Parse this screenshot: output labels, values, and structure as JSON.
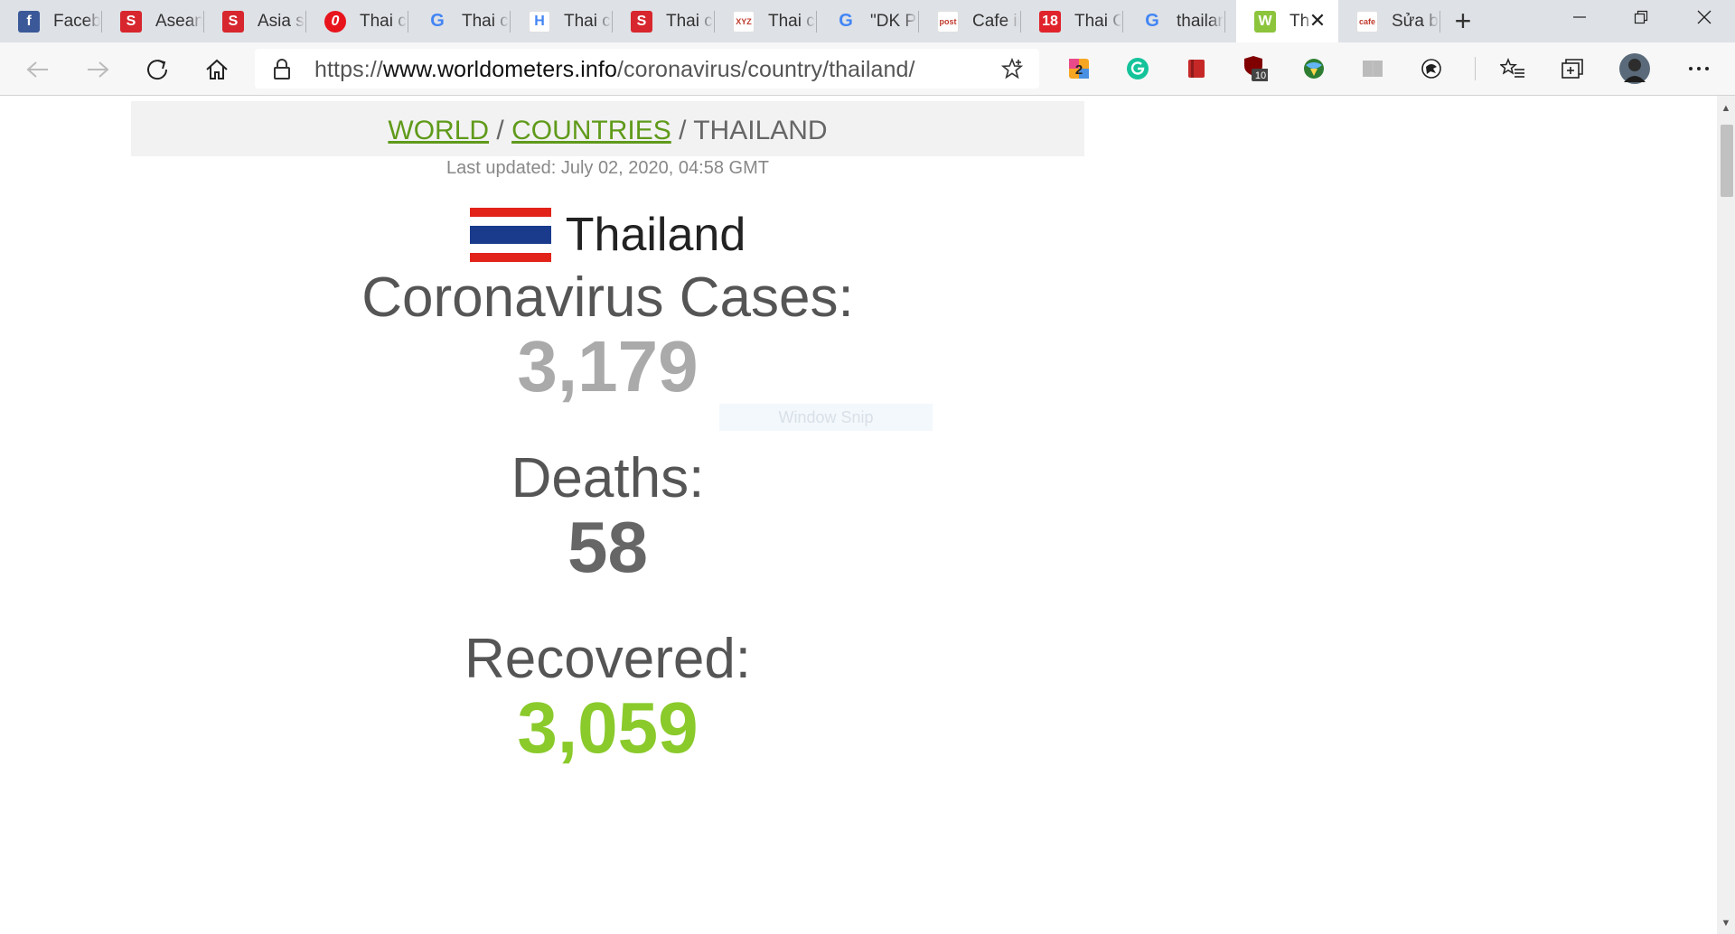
{
  "tabs": [
    {
      "label": "Facebook",
      "icon": "facebook-icon",
      "fav_text": "f",
      "fav_bg": "#3b5998"
    },
    {
      "label": "Asean+",
      "icon": "s-red-icon",
      "fav_text": "S",
      "fav_bg": "#d7262d"
    },
    {
      "label": "Asia stocks",
      "icon": "s-red-icon",
      "fav_text": "S",
      "fav_bg": "#d7262d"
    },
    {
      "label": "Thai cases",
      "icon": "opera-icon",
      "fav_text": "0",
      "fav_bg": "#e8141c"
    },
    {
      "label": "Thai cases",
      "icon": "google-icon",
      "fav_text": "G",
      "fav_bg": "#ffffff"
    },
    {
      "label": "Thai cases",
      "icon": "hl-icon",
      "fav_text": "H",
      "fav_bg": "#ffffff"
    },
    {
      "label": "Thai cases",
      "icon": "s-red-icon",
      "fav_text": "S",
      "fav_bg": "#d7262d"
    },
    {
      "label": "Thai cases",
      "icon": "xyz-icon",
      "fav_text": "XYZ",
      "fav_bg": "#ffffff"
    },
    {
      "label": "\"DK Park\"",
      "icon": "google-icon",
      "fav_text": "G",
      "fav_bg": "#ffffff"
    },
    {
      "label": "Cafe in",
      "icon": "post-icon",
      "fav_text": "post",
      "fav_bg": "#ffffff"
    },
    {
      "label": "Thai Cases",
      "icon": "eighteen-icon",
      "fav_text": "18",
      "fav_bg": "#e0232b"
    },
    {
      "label": "thailand",
      "icon": "google-icon",
      "fav_text": "G",
      "fav_bg": "#ffffff"
    },
    {
      "label": "Th",
      "icon": "worldometers-icon",
      "fav_text": "W",
      "fav_bg": "#8cc43c",
      "active": true
    },
    {
      "label": "Sửa bài",
      "icon": "cafe-icon",
      "fav_text": "cafe",
      "fav_bg": "#ffffff"
    }
  ],
  "address": {
    "scheme": "https://",
    "host": "www.worldometers.info",
    "path": "/coronavirus/country/thailand/"
  },
  "extensions": [
    {
      "name": "two-icon",
      "badge": ""
    },
    {
      "name": "grammarly-icon",
      "badge": ""
    },
    {
      "name": "red-book-icon",
      "badge": ""
    },
    {
      "name": "ublock-icon",
      "badge": "10"
    },
    {
      "name": "globe-download-icon",
      "badge": ""
    },
    {
      "name": "reader-icon",
      "badge": ""
    },
    {
      "name": "translate-icon",
      "badge": ""
    }
  ],
  "breadcrumb": {
    "world": "WORLD",
    "sep1": " / ",
    "countries": "COUNTRIES",
    "sep2": " / ",
    "current": "THAILAND"
  },
  "last_updated": "Last updated: July 02, 2020, 04:58 GMT",
  "country": "Thailand",
  "stats": {
    "cases_label": "Coronavirus Cases:",
    "cases_value": "3,179",
    "deaths_label": "Deaths:",
    "deaths_value": "58",
    "recovered_label": "Recovered:",
    "recovered_value": "3,059"
  },
  "snip_overlay": "Window Snip",
  "colors": {
    "link_green": "#609a1a",
    "cases_gray": "#aaaaaa",
    "deaths_gray": "#666666",
    "recovered_green": "#8aca2b",
    "flag_red": "#e2231a",
    "flag_blue": "#1a3b8c"
  }
}
